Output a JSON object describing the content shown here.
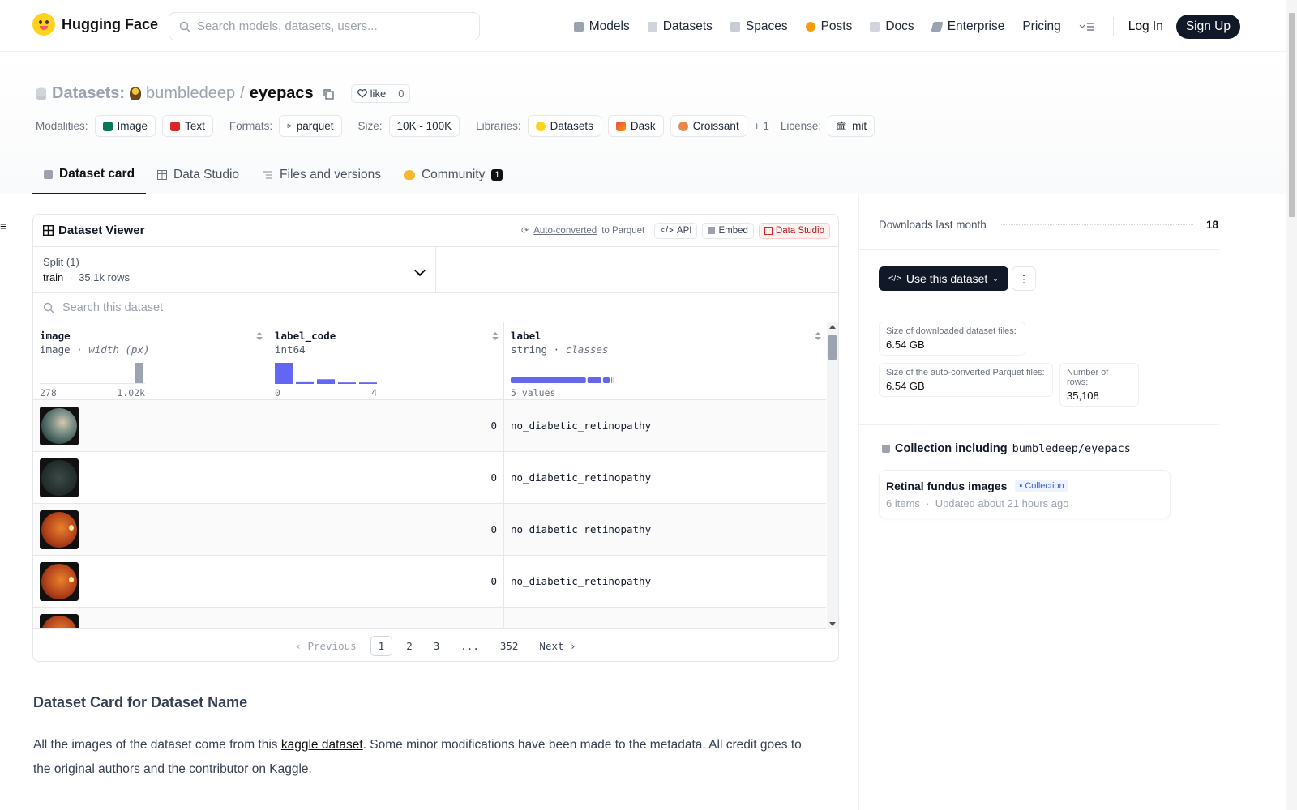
{
  "header": {
    "brand": "Hugging Face",
    "search_placeholder": "Search models, datasets, users...",
    "nav": [
      {
        "label": "Models",
        "color": "#6b7280"
      },
      {
        "label": "Datasets",
        "color": "#9ca3af"
      },
      {
        "label": "Spaces",
        "color": "#9ca3af"
      },
      {
        "label": "Posts",
        "color": "#f59e0b"
      },
      {
        "label": "Docs",
        "color": "#9ca3af"
      },
      {
        "label": "Enterprise",
        "color": "#6b7280"
      },
      {
        "label": "Pricing"
      }
    ],
    "login": "Log In",
    "signup": "Sign Up"
  },
  "dataset": {
    "section": "Datasets:",
    "owner": "bumbledeep",
    "name": "eyepacs",
    "like_label": "like",
    "like_count": "0",
    "tags": {
      "modalities_label": "Modalities:",
      "modalities": [
        "Image",
        "Text"
      ],
      "formats_label": "Formats:",
      "format": "parquet",
      "size_label": "Size:",
      "size": "10K - 100K",
      "libraries_label": "Libraries:",
      "libraries": [
        "Datasets",
        "Dask",
        "Croissant"
      ],
      "libraries_more": "+ 1",
      "license_label": "License:",
      "license": "mit"
    },
    "tabs": [
      "Dataset card",
      "Data Studio",
      "Files and versions",
      "Community"
    ],
    "community_count": "1"
  },
  "viewer": {
    "title": "Dataset Viewer",
    "auto_converted": "Auto-converted",
    "to_parquet": "to Parquet",
    "api": "API",
    "embed": "Embed",
    "data_studio": "Data Studio",
    "split_label": "Split (1)",
    "split_name": "train",
    "split_rows": "35.1k rows",
    "search_placeholder": "Search this dataset",
    "columns": [
      {
        "name": "image",
        "type": "image",
        "sub": "width (px)",
        "axis_min": "278",
        "axis_max": "1.02k"
      },
      {
        "name": "label_code",
        "type": "int64",
        "sub": "",
        "axis_min": "0",
        "axis_max": "4"
      },
      {
        "name": "label",
        "type": "string",
        "sub": "classes",
        "axis_min": "5 values",
        "axis_max": ""
      }
    ],
    "rows": [
      {
        "label_code": "0",
        "label": "no_diabetic_retinopathy"
      },
      {
        "label_code": "0",
        "label": "no_diabetic_retinopathy"
      },
      {
        "label_code": "0",
        "label": "no_diabetic_retinopathy"
      },
      {
        "label_code": "0",
        "label": "no_diabetic_retinopathy"
      },
      {
        "label_code": "",
        "label": ""
      }
    ],
    "label_code_hist": [
      1.0,
      0.12,
      0.22,
      0.07,
      0.07
    ],
    "label_bar": [
      0.74,
      0.15,
      0.08,
      0.02,
      0.01
    ],
    "pager": {
      "prev": "Previous",
      "pages": [
        "1",
        "2",
        "3",
        "...",
        "352"
      ],
      "next": "Next"
    }
  },
  "sidebar": {
    "downloads_label": "Downloads last month",
    "downloads_value": "18",
    "use_button": "Use this dataset",
    "size_downloaded_label": "Size of downloaded dataset files:",
    "size_downloaded": "6.54 GB",
    "size_parquet_label": "Size of the auto-converted Parquet files:",
    "size_parquet": "6.54 GB",
    "rows_label": "Number of rows:",
    "rows_value": "35,108",
    "collection_heading": "Collection including",
    "collection_repo": "bumbledeep/eyepacs",
    "collection_name": "Retinal fundus images",
    "collection_badge": "Collection",
    "collection_items": "6 items",
    "collection_updated": "Updated about 21 hours ago"
  },
  "card": {
    "heading": "Dataset Card for Dataset Name",
    "text_before": "All the images of the dataset come from this ",
    "link": "kaggle dataset",
    "text_after": ". Some minor modifications have been made to the metadata. All credit goes to the original authors and the contributor on Kaggle."
  }
}
